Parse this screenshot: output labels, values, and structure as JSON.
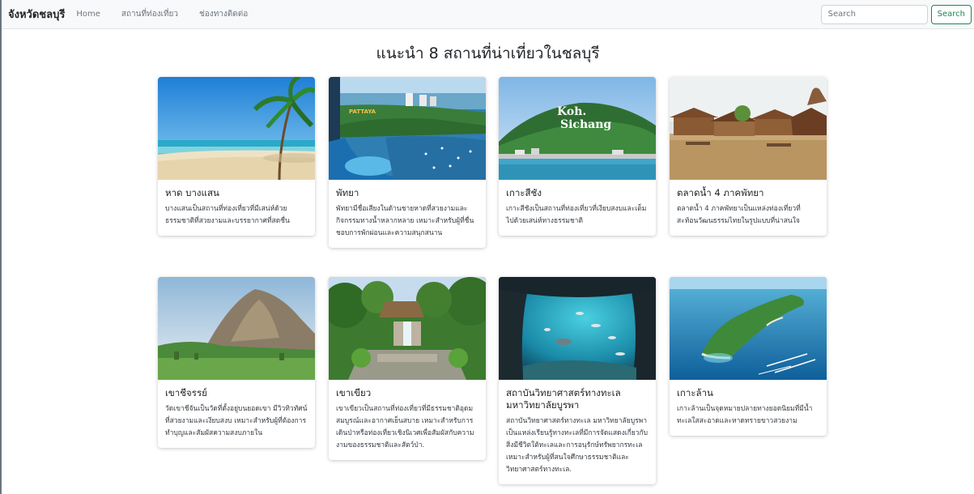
{
  "navbar": {
    "brand": "จังหวัดชลบุรี",
    "links": [
      "Home",
      "สถานที่ท่องเที่ยว",
      "ช่องทางติดต่อ"
    ],
    "search_placeholder": "Search",
    "search_button": "Search"
  },
  "page": {
    "title": "แนะนำ 8 สถานที่น่าเที่ยวในชลบุรี"
  },
  "cards": [
    {
      "title": "หาด บางแสน",
      "text": "บางแสนเป็นสถานที่ท่องเที่ยวที่มีเสน่ห์ด้วยธรรมชาติที่สวยงามและบรรยากาศที่สดชื่น"
    },
    {
      "title": "พัทยา",
      "text": "พัทยามีชื่อเสียงในด้านชายหาดที่สวยงามและกิจกรรมทางน้ำหลากหลาย เหมาะสำหรับผู้ที่ชื่นชอบการพักผ่อนและความสนุกสนาน"
    },
    {
      "title": "เกาะสีชัง",
      "text": "เกาะสีชังเป็นสถานที่ท่องเที่ยวที่เงียบสงบและเต็มไปด้วยเสน่ห์ทางธรรมชาติ",
      "image_caption_line1": "Koh.",
      "image_caption_line2": "Sichang"
    },
    {
      "title": "ตลาดน้ำ 4 ภาคพัทยา",
      "text": "ตลาดน้ำ 4 ภาคพัทยาเป็นแหล่งท่องเที่ยวที่สะท้อนวัฒนธรรมไทยในรูปแบบที่น่าสนใจ"
    },
    {
      "title": "เขาชีจรรย์",
      "text": "วัดเขาชีจันเป็นวัดที่ตั้งอยู่บนยอดเขา มีวิวทิวทัศน์ที่สวยงามและเงียบสงบ เหมาะสำหรับผู้ที่ต้องการทำบุญและสัมผัสความสงบภายใน"
    },
    {
      "title": "เขาเขียว",
      "text": "เขาเขียวเป็นสถานที่ท่องเที่ยวที่มีธรรมชาติอุดมสมบูรณ์และอากาศเย็นสบาย เหมาะสำหรับการเดินป่าหรือท่องเที่ยวเชิงนิเวศเพื่อสัมผัสกับความงามของธรรมชาติและสัตว์ป่า."
    },
    {
      "title": "สถาบันวิทยาศาสตร์ทางทะเล มหาวิทยาลัยบูรพา",
      "text": "สถาบันวิทยาศาสตร์ทางทะเล มหาวิทยาลัยบูรพา เป็นแหล่งเรียนรู้ทางทะเลที่มีการจัดแสดงเกี่ยวกับสิ่งมีชีวิตใต้ทะเลและการอนุรักษ์ทรัพยากรทะเล เหมาะสำหรับผู้ที่สนใจศึกษาธรรมชาติและวิทยาศาสตร์ทางทะเล."
    },
    {
      "title": "เกาะล้าน",
      "text": "เกาะล้านเป็นจุดหมายปลายทางยอดนิยมที่มีน้ำทะเลใสสะอาดและหาดทรายขาวสวยงาม"
    }
  ],
  "colors": {
    "accent_green": "#198754",
    "navbar_bg": "#f8f9fa"
  }
}
